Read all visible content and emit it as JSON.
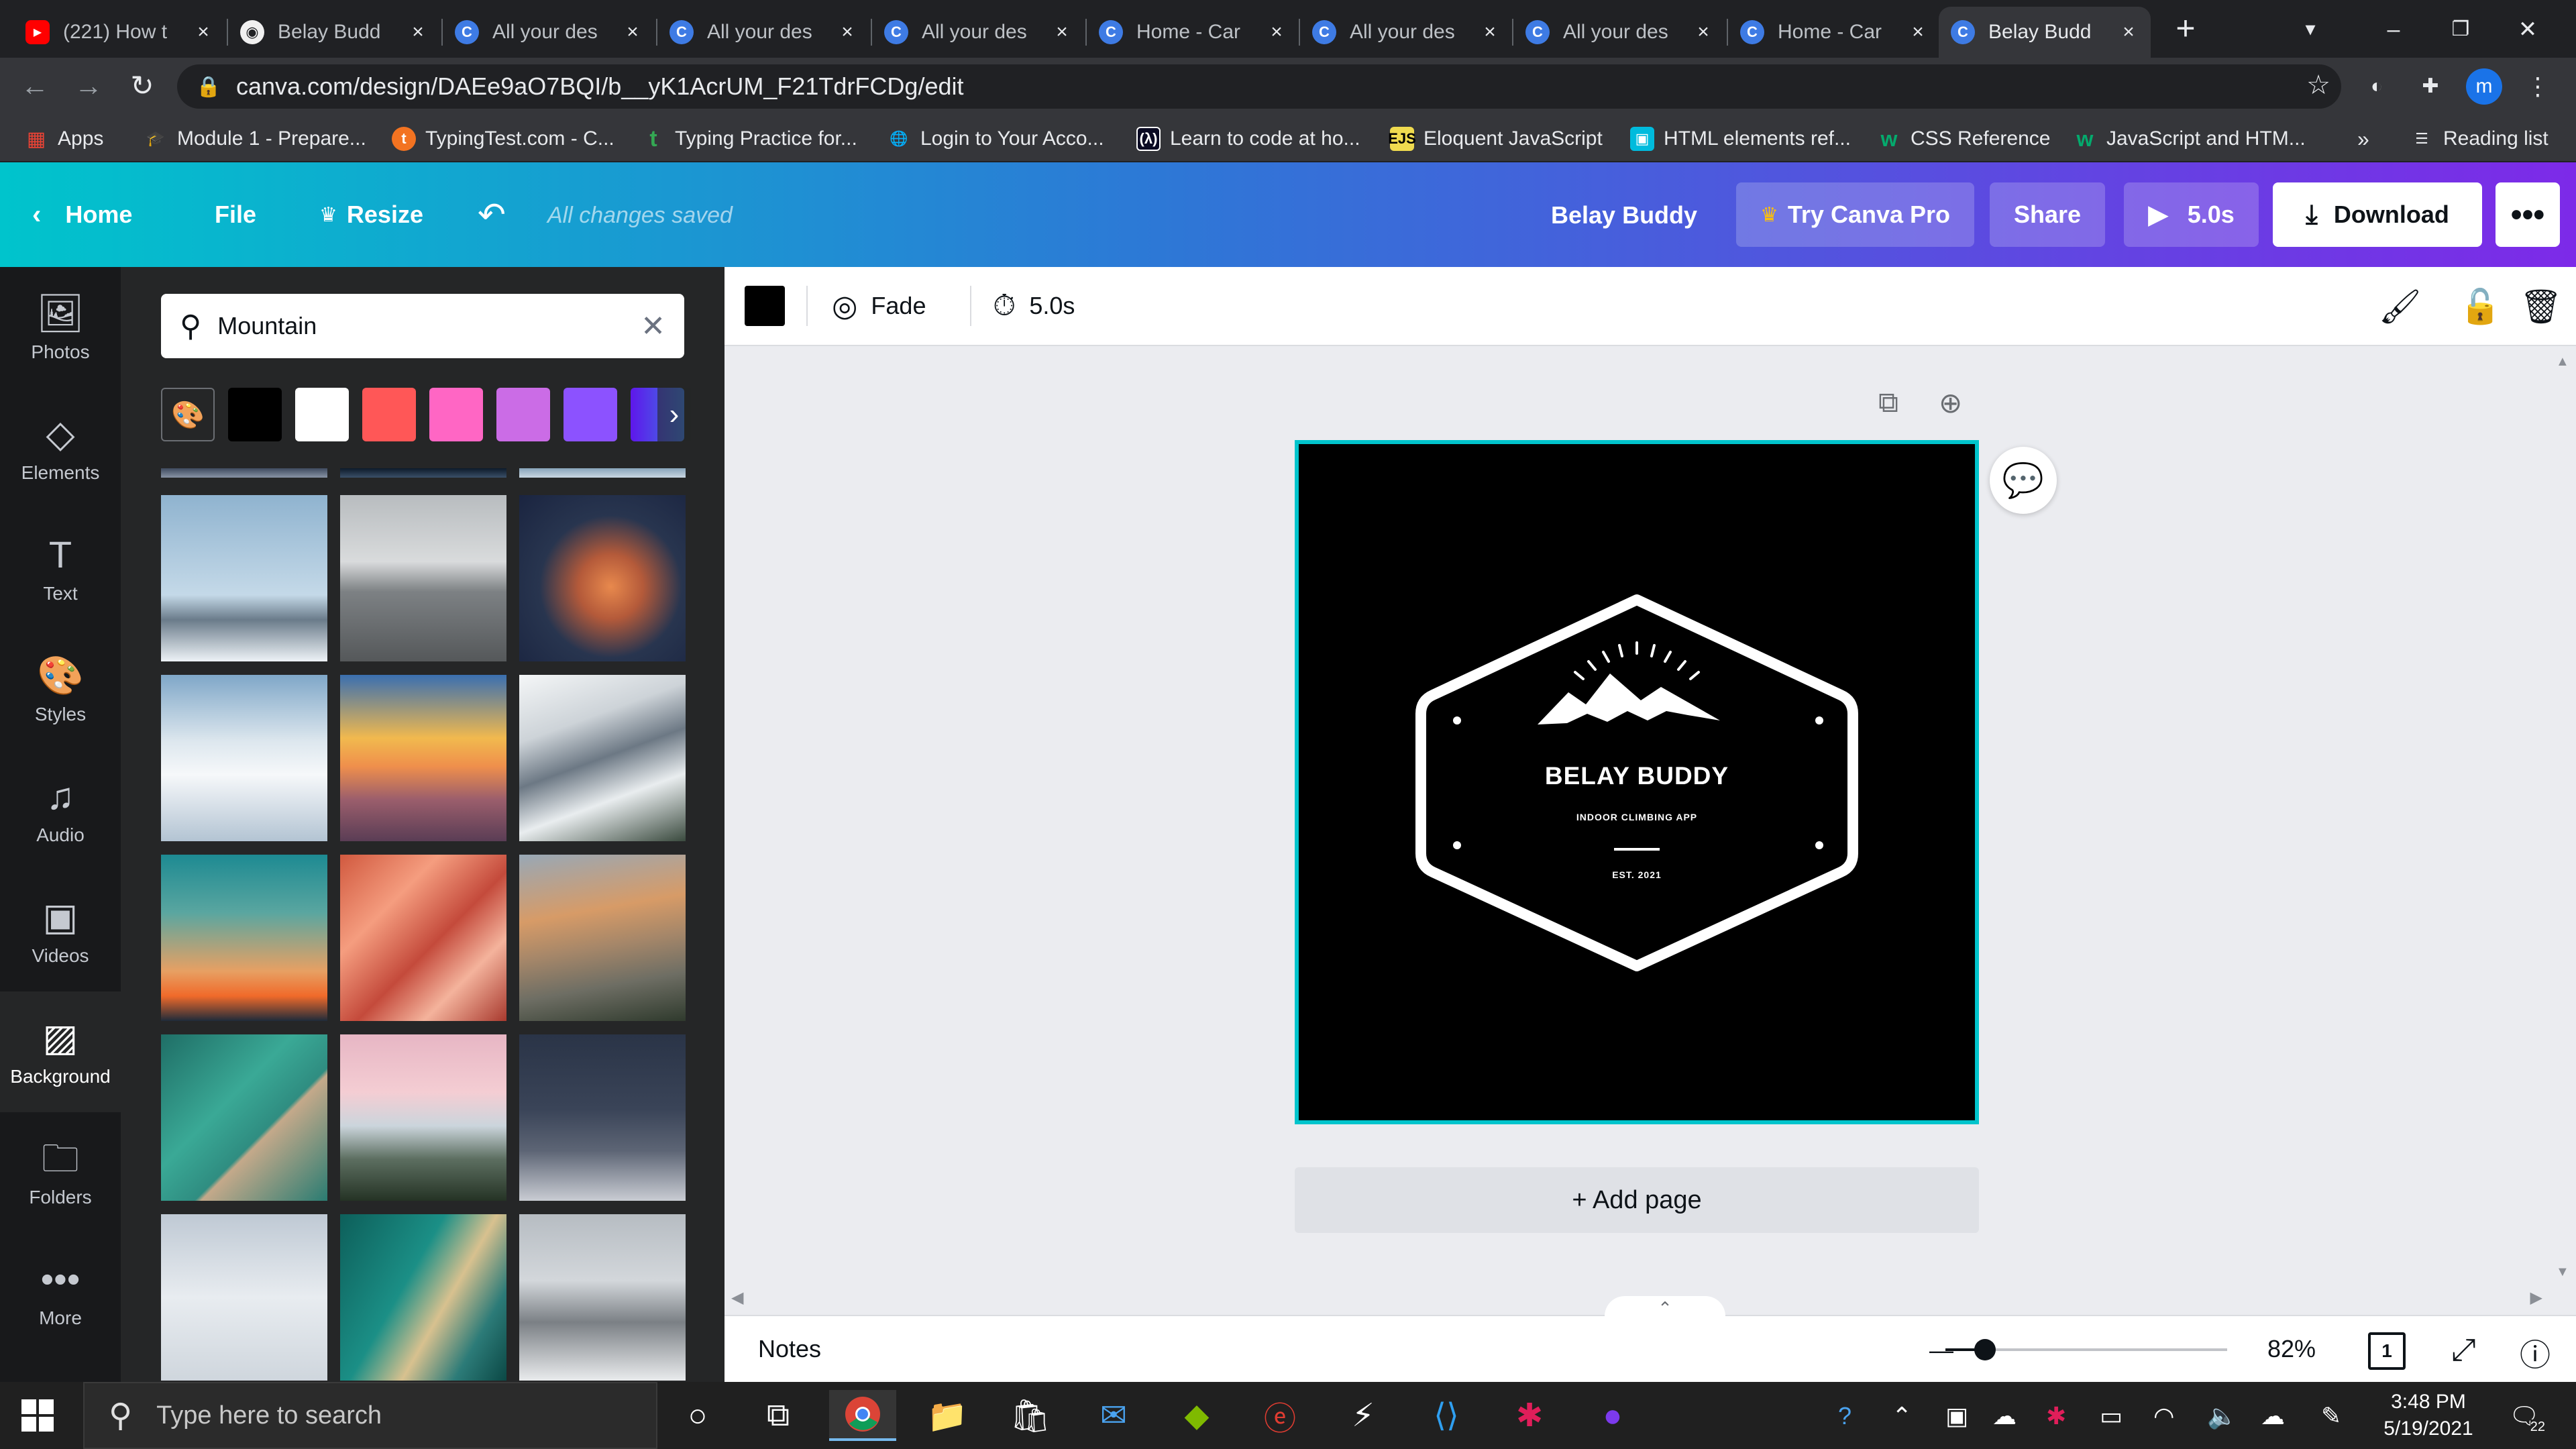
{
  "browser": {
    "tabs": [
      {
        "title": "(221) How t",
        "favicon": "youtube"
      },
      {
        "title": "Belay Budd",
        "favicon": "github"
      },
      {
        "title": "All your des",
        "favicon": "canva"
      },
      {
        "title": "All your des",
        "favicon": "canva"
      },
      {
        "title": "All your des",
        "favicon": "canva"
      },
      {
        "title": "Home - Car",
        "favicon": "canva"
      },
      {
        "title": "All your des",
        "favicon": "canva"
      },
      {
        "title": "All your des",
        "favicon": "canva"
      },
      {
        "title": "Home - Car",
        "favicon": "canva"
      },
      {
        "title": "Belay Budd",
        "favicon": "canva",
        "active": true
      }
    ],
    "url": "canva.com/design/DAEe9aO7BQI/b__yK1AcrUM_F21TdrFCDg/edit",
    "profile_initial": "m",
    "bookmarks": [
      {
        "label": "Apps"
      },
      {
        "label": "Module 1 - Prepare..."
      },
      {
        "label": "TypingTest.com - C..."
      },
      {
        "label": "Typing Practice for..."
      },
      {
        "label": "Login to Your Acco..."
      },
      {
        "label": "Learn to code at ho..."
      },
      {
        "label": "Eloquent JavaScript"
      },
      {
        "label": "HTML elements ref..."
      },
      {
        "label": "CSS Reference"
      },
      {
        "label": "JavaScript and HTM..."
      }
    ],
    "bookmarks_overflow": "»",
    "reading_list": "Reading list"
  },
  "canva": {
    "header": {
      "home": "Home",
      "file": "File",
      "resize": "Resize",
      "saved_status": "All changes saved",
      "design_name": "Belay Buddy",
      "try_pro": "Try Canva Pro",
      "share": "Share",
      "play_duration": "5.0s",
      "download": "Download",
      "more": "•••"
    },
    "rail": [
      {
        "label": "Photos",
        "icon": "photo-icon"
      },
      {
        "label": "Elements",
        "icon": "shapes-icon"
      },
      {
        "label": "Text",
        "icon": "text-icon"
      },
      {
        "label": "Styles",
        "icon": "palette-icon"
      },
      {
        "label": "Audio",
        "icon": "music-icon"
      },
      {
        "label": "Videos",
        "icon": "video-icon"
      },
      {
        "label": "Background",
        "icon": "background-icon",
        "active": true
      },
      {
        "label": "Folders",
        "icon": "folder-icon"
      },
      {
        "label": "More",
        "icon": "more-icon"
      }
    ],
    "panel": {
      "search_value": "Mountain",
      "swatches": [
        "#000000",
        "#ffffff",
        "#ff5757",
        "#ff66c4",
        "#cb6ce6",
        "#8c52ff",
        "#5e17eb"
      ]
    },
    "context_toolbar": {
      "color": "#000000",
      "animation": "Fade",
      "duration": "5.0s"
    },
    "canvas": {
      "logo_title": "BELAY BUDDY",
      "logo_subtitle": "INDOOR CLIMBING APP",
      "logo_est": "EST. 2021",
      "add_page": "+ Add page"
    },
    "bottom_bar": {
      "notes": "Notes",
      "zoom": "82%",
      "zoom_level": 0.14,
      "page_count": "1"
    }
  },
  "taskbar": {
    "search_placeholder": "Type here to search",
    "time": "3:48 PM",
    "date": "5/19/2021",
    "notification_count": "22"
  }
}
